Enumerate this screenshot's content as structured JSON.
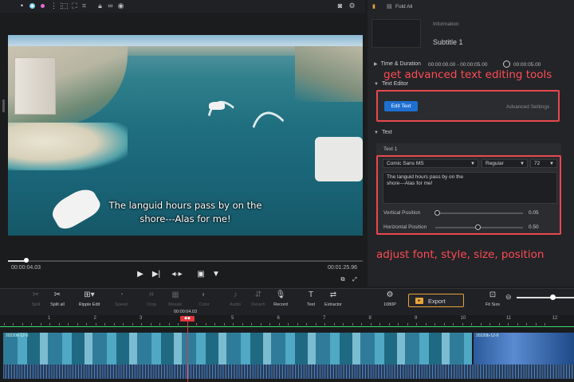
{
  "player": {
    "current_time": "00:00:04.03",
    "total_time": "00:01:25.96",
    "subtitle_line1": "The languid hours pass by on the",
    "subtitle_line2": "shore---Alas for me!",
    "progress_fraction": 0.05,
    "toolbar_icons": [
      "cursor-dot-icon",
      "blue-dot-icon",
      "pink-dot-icon",
      "grid-icon",
      "select-icon",
      "crop-icon",
      "lock-icon",
      "link-icon",
      "eye-icon"
    ]
  },
  "right_panel": {
    "fold_all": "Fold All",
    "information_label": "Information",
    "subtitle_name": "Subtitle 1",
    "time_duration": {
      "label": "Time & Duration",
      "range": "00:00:00.00 - 00:00:05.00",
      "duration": "00:00:05.00"
    },
    "text_editor": {
      "label": "Text Editor",
      "edit_button": "Edit Text",
      "advanced": "Advanced Settings"
    },
    "text": {
      "label": "Text",
      "item_label": "Text 1",
      "font": "Comic Sans MS",
      "style": "Regular",
      "size": "72",
      "content_line1": "The languid hours pass by on the",
      "content_line2": "shore---Alas for me!",
      "vertical_label": "Vertical Position",
      "vertical_value": "0.05",
      "horizontal_label": "Horizontal Position",
      "horizontal_value": "0.50"
    },
    "annotation_top": "get advanced text editing tools",
    "annotation_bottom": "adjust font, style, size, position"
  },
  "toolbar": {
    "tools": [
      {
        "label": "Split",
        "icon": "scissors-icon",
        "enabled": false
      },
      {
        "label": "Split all",
        "icon": "split-all-icon",
        "enabled": true
      },
      {
        "label": "Ripple Edit",
        "icon": "ripple-edit-icon",
        "enabled": true
      },
      {
        "label": "Speed",
        "icon": "speed-icon",
        "enabled": false
      },
      {
        "label": "Crop",
        "icon": "crop-icon",
        "enabled": false
      },
      {
        "label": "Mosaic",
        "icon": "mosaic-icon",
        "enabled": false
      },
      {
        "label": "Color",
        "icon": "color-icon",
        "enabled": false
      },
      {
        "label": "Audio",
        "icon": "audio-icon",
        "enabled": false
      },
      {
        "label": "Detach",
        "icon": "detach-icon",
        "enabled": false
      },
      {
        "label": "Record",
        "icon": "microphone-icon",
        "enabled": true
      },
      {
        "label": "Text",
        "icon": "text-icon",
        "enabled": true
      },
      {
        "label": "Extractor",
        "icon": "extractor-icon",
        "enabled": true
      },
      {
        "label": "1080P",
        "icon": "resolution-icon",
        "enabled": true
      },
      {
        "label": "Fit Size",
        "icon": "fit-size-icon",
        "enabled": true
      }
    ],
    "export_label": "Export"
  },
  "timeline": {
    "playhead_time": "00:00:04.03",
    "ruler": [
      "1",
      "2",
      "3",
      "4",
      "5",
      "6",
      "7",
      "8",
      "9",
      "10",
      "11",
      "12"
    ],
    "clip1_label": "20220b-12-0",
    "clip2_label": "20220b-12-0"
  },
  "colors": {
    "accent": "#e8484e",
    "export_border": "#e8a33a",
    "edit_button": "#1e6fd0",
    "timeline_green": "#3ddc6a"
  }
}
